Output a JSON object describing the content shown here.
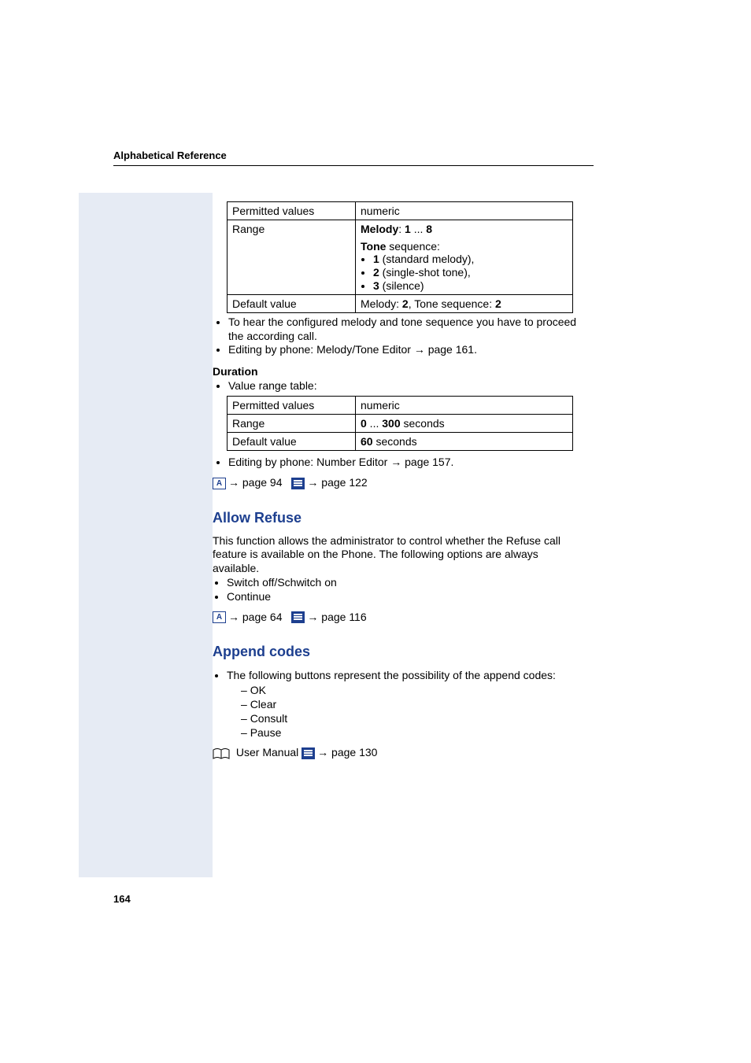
{
  "header": {
    "title": "Alphabetical Reference"
  },
  "page_number": "164",
  "table1": {
    "rows": [
      {
        "label": "Permitted values",
        "value": "numeric"
      },
      {
        "label": "Range",
        "melody_label": "Melody",
        "melody_sep": ": ",
        "melody_lo": "1",
        "melody_dots": " ... ",
        "melody_hi": "8",
        "tone_label": "Tone",
        "tone_rest": " sequence:",
        "items": [
          {
            "bold": "1",
            "rest": " (standard melody),"
          },
          {
            "bold": "2",
            "rest": " (single-shot tone),"
          },
          {
            "bold": "3",
            "rest": " (silence)"
          }
        ]
      },
      {
        "label": "Default value",
        "dv_m_pre": "Melody: ",
        "dv_m": "2",
        "dv_sep": ", Tone sequence: ",
        "dv_t": "2"
      }
    ]
  },
  "notes_after_table1": [
    "To hear the configured melody and tone sequence you have to proceed the according call.",
    "Editing by phone: Melody/Tone Editor → page 161."
  ],
  "duration_head": "Duration",
  "duration_sub": "Value range table:",
  "table2": {
    "rows": [
      {
        "label": "Permitted values",
        "value": "numeric"
      },
      {
        "label": "Range",
        "lo": "0",
        "dots": " ... ",
        "hi": "300",
        "unit": " seconds"
      },
      {
        "label": "Default value",
        "dv": "60",
        "dv_unit": " seconds"
      }
    ]
  },
  "duration_note": "Editing by phone: Number Editor → page 157.",
  "ref_line1": {
    "a_icon": "A",
    "a_text": "→ page 94",
    "b_text": "→ page 122"
  },
  "allow_refuse": {
    "heading": "Allow Refuse",
    "body": "This function allows the administrator to control whether the Refuse call feature is available on the Phone. The following options are always available.",
    "opts": [
      "Switch off/Schwitch on",
      "Continue"
    ],
    "ref": {
      "a_icon": "A",
      "a_text": "→ page 64",
      "b_text": "→ page 116"
    }
  },
  "append_codes": {
    "heading": "Append codes",
    "intro": "The following buttons represent the possibility of the append codes:",
    "items": [
      "OK",
      "Clear",
      "Consult",
      "Pause"
    ],
    "ref_text": " User Manual ",
    "ref_link": "→ page 130"
  }
}
